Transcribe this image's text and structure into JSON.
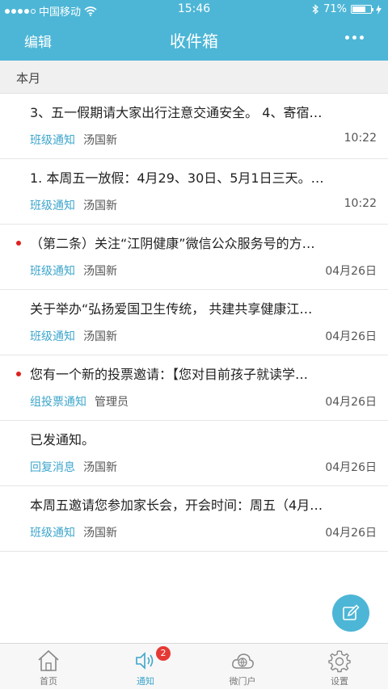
{
  "status": {
    "carrier": "中国移动",
    "time": "15:46",
    "battery": "71%",
    "battery_level": 0.71
  },
  "header": {
    "left_label": "编辑",
    "title": "收件箱"
  },
  "section_label": "本月",
  "items": [
    {
      "title": "3、五一假期请大家出行注意交通安全。 4、寄宿…",
      "tag": "班级通知",
      "author": "汤国新",
      "time": "10:22",
      "unread": false
    },
    {
      "title": "1. 本周五一放假：4月29、30日、5月1日三天。…",
      "tag": "班级通知",
      "author": "汤国新",
      "time": "10:22",
      "unread": false
    },
    {
      "title": "（第二条）关注“江阴健康”微信公众服务号的方…",
      "tag": "班级通知",
      "author": "汤国新",
      "time": "04月26日",
      "unread": true
    },
    {
      "title": " 关于举办“弘扬爱国卫生传统， 共建共享健康江…",
      "tag": "班级通知",
      "author": "汤国新",
      "time": "04月26日",
      "unread": false
    },
    {
      "title": "您有一个新的投票邀请：【您对目前孩子就读学…",
      "tag": "组投票通知",
      "author": "管理员",
      "time": "04月26日",
      "unread": true
    },
    {
      "title": "已发通知。",
      "tag": "回复消息",
      "author": "汤国新",
      "time": "04月26日",
      "unread": false
    },
    {
      "title": "本周五邀请您参加家长会，开会时间：周五（4月…",
      "tag": "班级通知",
      "author": "汤国新",
      "time": "04月26日",
      "unread": false
    }
  ],
  "tabs": [
    {
      "label": "首页",
      "icon": "home-icon"
    },
    {
      "label": "通知",
      "icon": "notification-icon",
      "badge": "2"
    },
    {
      "label": "微门户",
      "icon": "cloud-icon"
    },
    {
      "label": "设置",
      "icon": "gear-icon"
    }
  ],
  "colors": {
    "accent": "#4db6d6",
    "tag": "#3ea6cc",
    "unread_dot": "#e02020",
    "badge": "#e53935"
  }
}
